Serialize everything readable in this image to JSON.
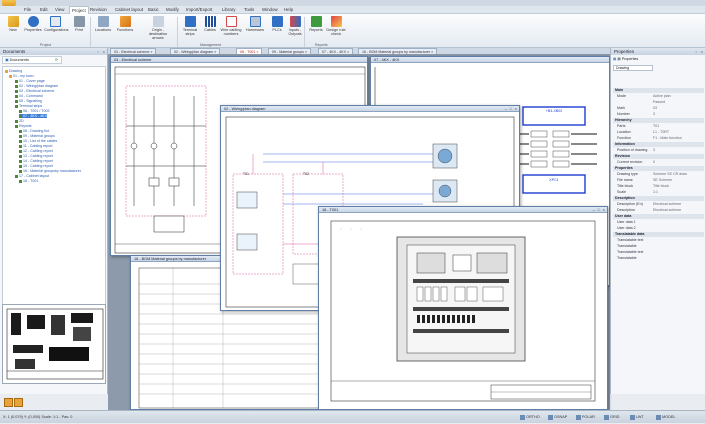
{
  "menu": [
    "File",
    "Edit",
    "View",
    "Project",
    "Revision",
    "Cabinet layout",
    "Basic",
    "Modify",
    "Import/Export",
    "Library",
    "Tools",
    "Window",
    "Help"
  ],
  "menu_active_index": 3,
  "ribbon": {
    "buttons": [
      "New",
      "Properties",
      "Configurations",
      "Print",
      "Locations",
      "Functions",
      "Origin - destination arrows",
      "Terminal strips",
      "Cables",
      "Wire cabling numbers",
      "Harnesses",
      "PLCs",
      "Inputs - Outputs",
      "Reports",
      "Design rule check"
    ],
    "groups": [
      "Project",
      "Management",
      "Reports"
    ]
  },
  "left_panel": {
    "title": "Documents",
    "tab": "Documents",
    "tree": [
      "Drawing",
      "01 - my town",
      "01 - Cover page",
      "02 - Wiring/plan diagram",
      "03 - Electrical scheme",
      "04 - Command",
      "05 - Signalling",
      "Terminal strips",
      "06 - T001 / T002",
      "07 - 4KX - 4KX",
      "2D",
      "Reports",
      "08 - Drawing list",
      "09 - Material groups",
      "10 - List of the cables",
      "11 - Cabling report",
      "12 - Cabling report",
      "13 - Cabling report",
      "14 - Cabling report",
      "15 - Cabling report",
      "16 - Material groupsby manufacturer",
      "17 - Cabinet layout",
      "18 - T001"
    ],
    "selected_index": 9
  },
  "tabs": [
    "03 - Electrical scheme",
    "02 - Wiring/plan diagram",
    "06 - T001",
    "09 - Material groups",
    "07 - 4KX - 4KX",
    "16 - BOM Material groups by manufacturer"
  ],
  "windows": {
    "scheme": "03 - Electrical scheme",
    "wiring": "02 - Wiring/plan diagram",
    "cabinet": "18 - T001",
    "material": "16 - BOM Material groups by manufacturer",
    "fourkx": "07 - 4KX - 4KX",
    "fourkx_block1": "+B3-XB02",
    "fourkx_block2": "XPC1"
  },
  "wiring_boxes": [
    "T01",
    "T02"
  ],
  "right_panel": {
    "title": "Properties",
    "tab": "Drawing",
    "rows": [
      {
        "cat": "Main"
      },
      {
        "k": "Mode",
        "v": "Active plan"
      },
      {
        "k": "",
        "v": "Passed"
      },
      {
        "k": "Mark",
        "v": "03"
      },
      {
        "k": "Number",
        "v": "3"
      },
      {
        "cat": "Hierarchy"
      },
      {
        "k": "Parts",
        "v": "T01"
      },
      {
        "k": "Location",
        "v": "L1 - T0RT"
      },
      {
        "k": "Function",
        "v": "F1 - Main function"
      },
      {
        "cat": "Information"
      },
      {
        "k": "Position of drawing",
        "v": "3"
      },
      {
        "cat": "Revision"
      },
      {
        "k": "Current revision",
        "v": "0"
      },
      {
        "cat": "Properties"
      },
      {
        "k": "Drawing type",
        "v": "Scheme SE CR draw"
      },
      {
        "k": "File name",
        "v": "SE Scheme"
      },
      {
        "k": "Title block",
        "v": "Title block"
      },
      {
        "k": "Scale",
        "v": "1:1"
      },
      {
        "cat": "Description"
      },
      {
        "k": "Description (En)",
        "v": "Electrical scheme"
      },
      {
        "k": "Description",
        "v": "Electrical scheme"
      },
      {
        "cat": "User data"
      },
      {
        "k": "User data 1",
        "v": ""
      },
      {
        "k": "User data 2",
        "v": ""
      },
      {
        "cat": "Translatable data"
      },
      {
        "k": "Translatable text",
        "v": ""
      },
      {
        "k": "Translatable",
        "v": ""
      },
      {
        "k": "Translatable text",
        "v": ""
      },
      {
        "k": "Translatable",
        "v": ""
      }
    ]
  },
  "status": {
    "left": "X: 1 (0.079) Y:  (0.000) Scale: 1:1 - Pas: 0",
    "items": [
      "ORTHO",
      "OSNAP",
      "POLAR",
      "GRID",
      "LWT",
      "MODEL"
    ]
  },
  "colors": {
    "ribbon_blue": "#2f6fc4",
    "highlight": "#3d7fd6",
    "frame_blue": "#1c3fd0",
    "wire_pink": "#d85c9a",
    "wire_blue": "#4a6fd8"
  }
}
